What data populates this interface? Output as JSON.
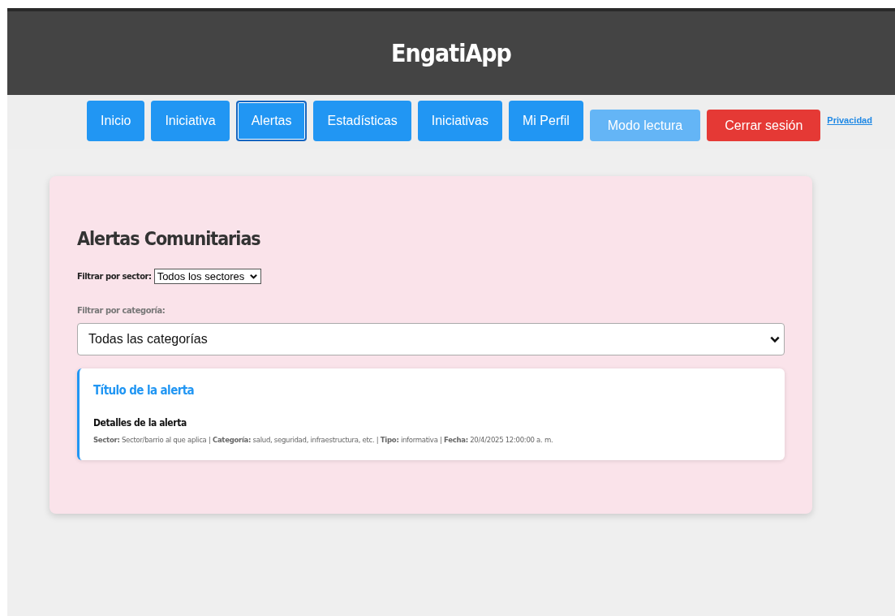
{
  "header": {
    "title": "EngatiApp"
  },
  "nav": [
    {
      "label": "Inicio",
      "kind": "nav",
      "selected": false
    },
    {
      "label": "Iniciativa",
      "kind": "nav",
      "selected": false
    },
    {
      "label": "Alertas",
      "kind": "nav",
      "selected": true
    },
    {
      "label": "Estadísticas",
      "kind": "nav",
      "selected": false
    },
    {
      "label": "Iniciativas",
      "kind": "nav",
      "selected": false
    },
    {
      "label": "Mi Perfil",
      "kind": "nav",
      "selected": false
    },
    {
      "label": "Modo lectura",
      "kind": "toggle",
      "selected": false
    },
    {
      "label": "Cerrar sesión",
      "kind": "danger",
      "selected": false
    },
    {
      "label": "Privacidad",
      "kind": "link",
      "selected": false
    }
  ],
  "panel": {
    "title": "Alertas Comunitarias",
    "sector_filter": {
      "label": "Filtrar por sector:",
      "value": "Todos los sectores"
    },
    "category_filter": {
      "label": "Filtrar por categoría:",
      "value": "Todas las categorías"
    },
    "alerts": [
      {
        "title": "Título de la alerta",
        "details": "Detalles de la alerta",
        "meta": "**Sector:** Sector/barrio al que aplica | **Categoría:** salud, seguridad, infraestructura, etc. | **Tipo:** informativa | **Fecha:** 20/4/2025 12:00:00 a. m."
      }
    ]
  }
}
